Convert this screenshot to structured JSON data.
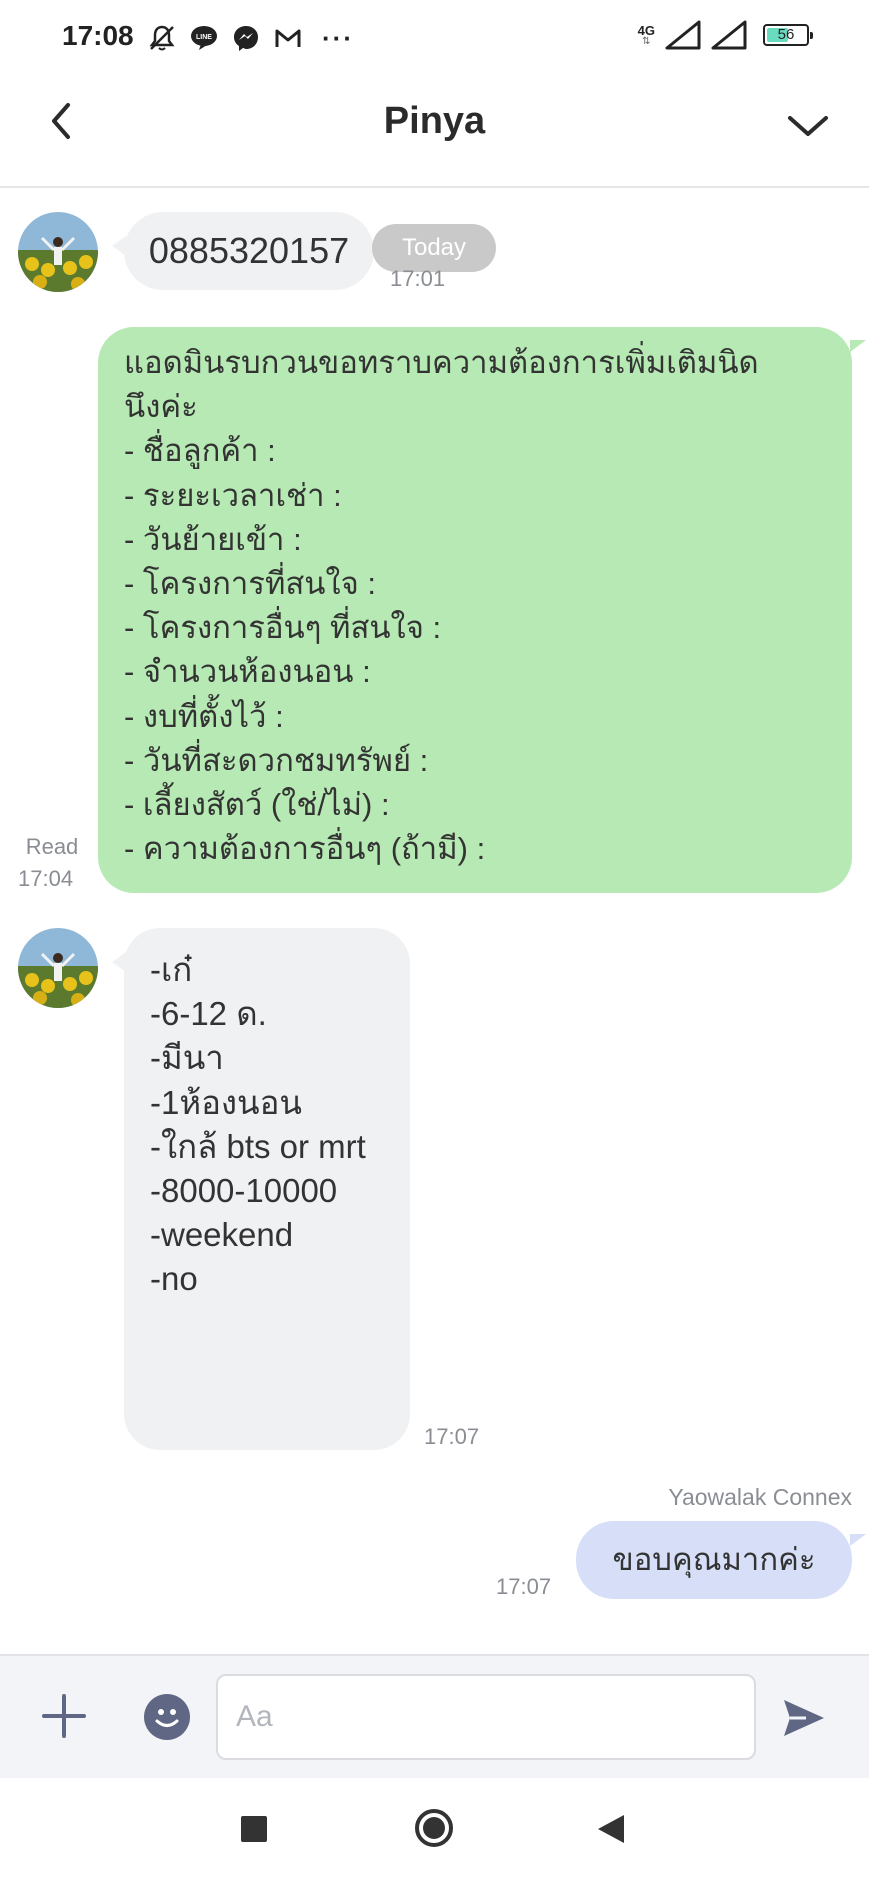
{
  "status_bar": {
    "time": "17:08",
    "icons": [
      "do-not-disturb-icon",
      "line-icon",
      "messenger-icon",
      "gmail-icon"
    ],
    "more": "···",
    "network": "4G",
    "battery": "56",
    "battery_level": 0.56
  },
  "header": {
    "title": "Pinya"
  },
  "chat": {
    "date_pill": "Today",
    "messages": [
      {
        "sender": "contact",
        "text": "0885320157",
        "time": "17:01"
      },
      {
        "sender": "me",
        "read_label": "Read",
        "time": "17:04",
        "lines": [
          "แอดมินรบกวนขอทราบความต้องการเพิ่มเติมนิด",
          "นึงค่ะ",
          "- ชื่อลูกค้า :",
          "- ระยะเวลาเช่า :",
          "- วันย้ายเข้า :",
          "- โครงการที่สนใจ :",
          "- โครงการอื่นๆ ที่สนใจ :",
          "- จำนวนห้องนอน :",
          "- งบที่ตั้งไว้ :",
          "- วันที่สะดวกชมทรัพย์ :",
          "- เลี้ยงสัตว์ (ใช่/ไม่) :",
          "- ความต้องการอื่นๆ (ถ้ามี) :"
        ]
      },
      {
        "sender": "contact",
        "time": "17:07",
        "lines": [
          "-เก๋",
          "-6-12 ด.",
          "-มีนา",
          "-1ห้องนอน",
          "-ใกล้ bts or mrt",
          "-8000-10000",
          "-weekend",
          "-no"
        ]
      },
      {
        "sender": "me",
        "sender_name": "Yaowalak Connex",
        "text": "ขอบคุณมากค่ะ",
        "time": "17:07"
      }
    ]
  },
  "input_bar": {
    "placeholder": "Aa"
  },
  "colors": {
    "outgoing_green": "#b6e9b3",
    "outgoing_blue": "#d6dff7",
    "incoming": "#f0f1f3"
  }
}
